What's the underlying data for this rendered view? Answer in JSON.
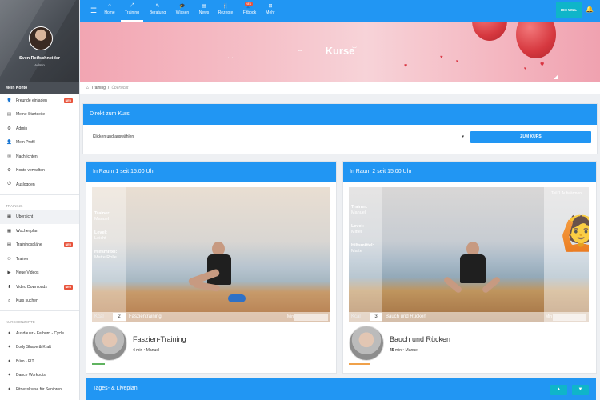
{
  "profile": {
    "name": "Sven Reifschneider",
    "role": "Admin"
  },
  "account": {
    "header": "Mein Konto",
    "items": [
      {
        "label": "Freunde einladen",
        "icon": "invite-icon",
        "badge": "NEU"
      },
      {
        "label": "Meine Startseite",
        "icon": "home-page-icon"
      },
      {
        "label": "Admin",
        "icon": "admin-icon"
      },
      {
        "label": "Mein Profil",
        "icon": "user-icon"
      },
      {
        "label": "Nachrichten",
        "icon": "messages-icon"
      },
      {
        "label": "Konto verwalten",
        "icon": "gear-icon"
      },
      {
        "label": "Ausloggen",
        "icon": "power-icon"
      }
    ]
  },
  "training": {
    "header": "Training",
    "items": [
      {
        "label": "Übersicht",
        "icon": "overview-icon"
      },
      {
        "label": "Wochenplan",
        "icon": "calendar-icon"
      },
      {
        "label": "Trainingspläne",
        "icon": "plans-icon",
        "badge": "NEU"
      },
      {
        "label": "Trainer",
        "icon": "trainer-icon"
      },
      {
        "label": "Neue Videos",
        "icon": "video-icon"
      },
      {
        "label": "Video Downloads",
        "icon": "download-icon",
        "badge": "NEU"
      },
      {
        "label": "Kurs suchen",
        "icon": "search-icon"
      }
    ]
  },
  "kurskonzepte": {
    "header": "Kurskonzepte",
    "items": [
      {
        "label": "Ausdauer - Fatburn - Cycle"
      },
      {
        "label": "Body Shape & Kraft"
      },
      {
        "label": "Büro - FIT"
      },
      {
        "label": "Dance Workouts"
      },
      {
        "label": "Fitnesskurse für Senioren"
      }
    ]
  },
  "topnav": {
    "items": [
      {
        "label": "Home",
        "icon": "⌂"
      },
      {
        "label": "Training",
        "icon": "⤢"
      },
      {
        "label": "Beratung",
        "icon": "✎"
      },
      {
        "label": "Wissen",
        "icon": "🎓"
      },
      {
        "label": "News",
        "icon": "▤"
      },
      {
        "label": "Rezepte",
        "icon": "🍴"
      },
      {
        "label": "Fitbook",
        "icon": "👥",
        "badge": "NEU"
      },
      {
        "label": "Mehr",
        "icon": "⊞"
      }
    ],
    "cta": "ICH WILL"
  },
  "hero": {
    "title": "Kurse"
  },
  "breadcrumb": {
    "root": "Training",
    "sep": "/",
    "current": "Übersicht"
  },
  "direkt": {
    "title": "Direkt zum Kurs",
    "select_value": "Klicken und auswählen",
    "button": "ZUM KURS"
  },
  "raum1": {
    "title": "In Raum 1 seit 15:00 Uhr",
    "video": {
      "trainer_label": "Trainer:",
      "trainer": "Manuel",
      "level_label": "Level:",
      "level": "Leicht",
      "hilfs_label": "Hilfsmittel:",
      "hilfs": "Matte Rolle",
      "kcal_label": "Kcal",
      "kcal": "2",
      "name": "Faszientraining",
      "min": "Min"
    },
    "course": {
      "title": "Faszien-Training",
      "duration": "4",
      "meta": "min • Manuel",
      "color": "#5fb35f"
    }
  },
  "raum2": {
    "title": "In Raum 2 seit 15:00 Uhr",
    "video": {
      "trainer_label": "Trainer:",
      "trainer": "Manuel",
      "level_label": "Level:",
      "level": "Mittel",
      "hilfs_label": "Hilfsmittel:",
      "hilfs": "Matte",
      "kcal_label": "Kcal",
      "kcal": "3",
      "name": "Bauch und Rücken",
      "min": "Min",
      "side_title": "Teil 1 Aufwärmen"
    },
    "course": {
      "title": "Bauch und Rücken",
      "duration": "45",
      "meta": "min • Manuel",
      "color": "#f0a14a"
    }
  },
  "tages": {
    "title": "Tages- & Liveplan",
    "up": "▲",
    "down": "▼"
  }
}
